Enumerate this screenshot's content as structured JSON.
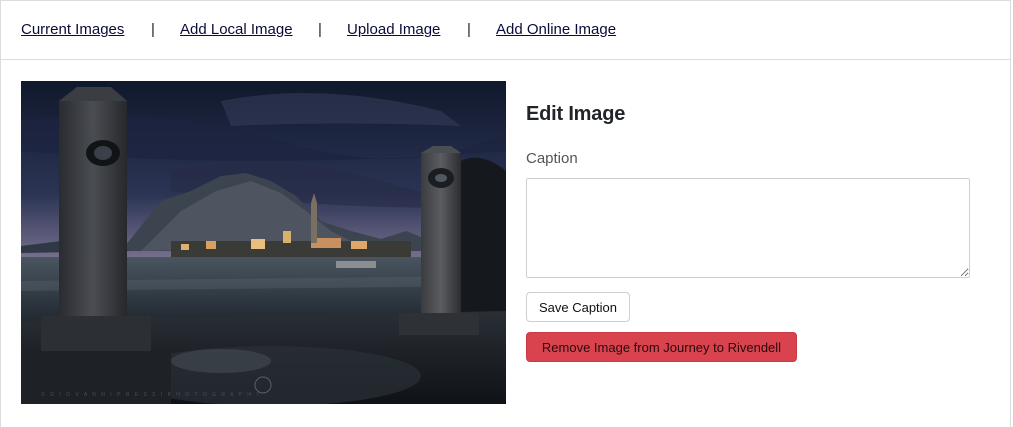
{
  "nav": {
    "links": [
      "Current Images",
      "Add Local Image",
      "Upload Image",
      "Add Online Image"
    ],
    "separator": "|"
  },
  "image": {
    "alt": "Lakeside town at dusk framed by two stone pillars",
    "watermark": "© G I O V A N N I   P R E S S I   P H O T O G R A P H Y"
  },
  "editor": {
    "title": "Edit Image",
    "caption_label": "Caption",
    "caption_value": "",
    "save_label": "Save Caption",
    "remove_label": "Remove Image from Journey to Rivendell"
  },
  "colors": {
    "link": "#0b0b3b",
    "danger": "#d9434d",
    "border": "#dcdcdc"
  }
}
